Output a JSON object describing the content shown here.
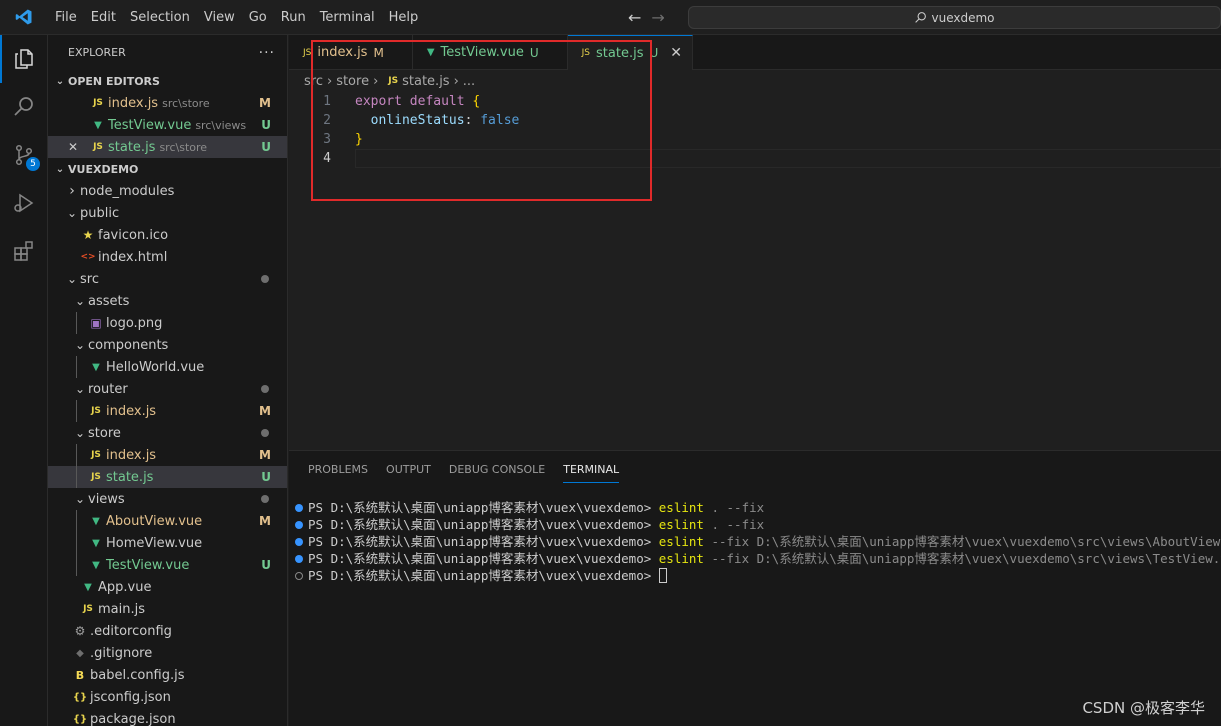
{
  "menu": [
    "File",
    "Edit",
    "Selection",
    "View",
    "Go",
    "Run",
    "Terminal",
    "Help"
  ],
  "search": {
    "text": "vuexdemo"
  },
  "activity": {
    "scm_badge": "5"
  },
  "explorer": {
    "title": "EXPLORER",
    "more": "···",
    "open_editors_title": "OPEN EDITORS",
    "open_editors": [
      {
        "name": "index.js",
        "desc": "src\\store",
        "status": "M",
        "type": "js"
      },
      {
        "name": "TestView.vue",
        "desc": "src\\views",
        "status": "U",
        "type": "vue"
      },
      {
        "name": "state.js",
        "desc": "src\\store",
        "status": "U",
        "type": "js"
      }
    ],
    "project_title": "VUEXDEMO",
    "tree": [
      {
        "name": "node_modules",
        "kind": "folder",
        "open": false,
        "depth": 0
      },
      {
        "name": "public",
        "kind": "folder",
        "open": true,
        "depth": 0
      },
      {
        "name": "favicon.ico",
        "kind": "star",
        "depth": 1
      },
      {
        "name": "index.html",
        "kind": "html",
        "depth": 1
      },
      {
        "name": "src",
        "kind": "folder",
        "open": true,
        "depth": 0,
        "dot": true
      },
      {
        "name": "assets",
        "kind": "folder",
        "open": true,
        "depth": 1
      },
      {
        "name": "logo.png",
        "kind": "img",
        "depth": 2
      },
      {
        "name": "components",
        "kind": "folder",
        "open": true,
        "depth": 1
      },
      {
        "name": "HelloWorld.vue",
        "kind": "vue",
        "depth": 2
      },
      {
        "name": "router",
        "kind": "folder",
        "open": true,
        "depth": 1,
        "dot": true
      },
      {
        "name": "index.js",
        "kind": "js",
        "depth": 2,
        "status": "M"
      },
      {
        "name": "store",
        "kind": "folder",
        "open": true,
        "depth": 1,
        "dot": true
      },
      {
        "name": "index.js",
        "kind": "js",
        "depth": 2,
        "status": "M"
      },
      {
        "name": "state.js",
        "kind": "js",
        "depth": 2,
        "status": "U",
        "selected": true
      },
      {
        "name": "views",
        "kind": "folder",
        "open": true,
        "depth": 1,
        "dot": true
      },
      {
        "name": "AboutView.vue",
        "kind": "vue",
        "depth": 2,
        "status": "M"
      },
      {
        "name": "HomeView.vue",
        "kind": "vue",
        "depth": 2
      },
      {
        "name": "TestView.vue",
        "kind": "vue",
        "depth": 2,
        "status": "U"
      },
      {
        "name": "App.vue",
        "kind": "vue",
        "depth": 1
      },
      {
        "name": "main.js",
        "kind": "js",
        "depth": 1
      },
      {
        "name": ".editorconfig",
        "kind": "gear",
        "depth": 0
      },
      {
        "name": ".gitignore",
        "kind": "git",
        "depth": 0
      },
      {
        "name": "babel.config.js",
        "kind": "babel",
        "depth": 0
      },
      {
        "name": "jsconfig.json",
        "kind": "json",
        "depth": 0
      },
      {
        "name": "package.json",
        "kind": "json",
        "depth": 0
      }
    ]
  },
  "tabs": [
    {
      "name": "index.js",
      "status": "M",
      "type": "js"
    },
    {
      "name": "TestView.vue",
      "status": "U",
      "type": "vue"
    },
    {
      "name": "state.js",
      "status": "U",
      "type": "js",
      "active": true
    }
  ],
  "breadcrumb": {
    "p1": "src",
    "p2": "store",
    "p3": "state.js",
    "p4": "..."
  },
  "code": {
    "l1a": "export",
    "l1b": "default",
    "l1c": "{",
    "l2a": "onlineStatus",
    "l2b": ":",
    "l2c": "false",
    "l3a": "}"
  },
  "panel": {
    "tabs": [
      "PROBLEMS",
      "OUTPUT",
      "DEBUG CONSOLE",
      "TERMINAL"
    ],
    "active_tab": "TERMINAL",
    "lines": [
      {
        "prompt": "PS D:\\系统默认\\桌面\\uniapp博客素材\\vuex\\vuexdemo> ",
        "cmd": "eslint",
        "rest": " . --fix"
      },
      {
        "prompt": "PS D:\\系统默认\\桌面\\uniapp博客素材\\vuex\\vuexdemo> ",
        "cmd": "eslint",
        "rest": " . --fix"
      },
      {
        "prompt": "PS D:\\系统默认\\桌面\\uniapp博客素材\\vuex\\vuexdemo> ",
        "cmd": "eslint",
        "rest": " --fix D:\\系统默认\\桌面\\uniapp博客素材\\vuex\\vuexdemo\\src\\views\\AboutView.vu"
      },
      {
        "prompt": "PS D:\\系统默认\\桌面\\uniapp博客素材\\vuex\\vuexdemo> ",
        "cmd": "eslint",
        "rest": " --fix D:\\系统默认\\桌面\\uniapp博客素材\\vuex\\vuexdemo\\src\\views\\TestView.vue"
      }
    ],
    "last_prompt": "PS D:\\系统默认\\桌面\\uniapp博客素材\\vuex\\vuexdemo> "
  },
  "watermark": "CSDN @极客李华"
}
